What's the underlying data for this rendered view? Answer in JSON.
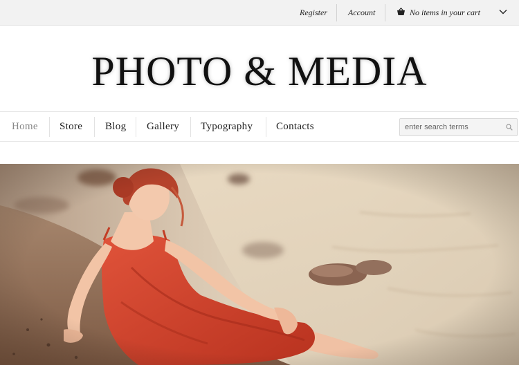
{
  "topbar": {
    "register_label": "Register",
    "account_label": "Account",
    "cart_label": "No items in your cart",
    "cart_icon": "basket-icon",
    "dropdown_icon": "chevron-down-icon"
  },
  "logo": {
    "text": "PHOTO & MEDIA"
  },
  "nav": {
    "items": [
      {
        "label": "Home",
        "active": true
      },
      {
        "label": "Store"
      },
      {
        "label": "Blog"
      },
      {
        "label": "Gallery"
      },
      {
        "label": "Typography"
      },
      {
        "label": "Contacts"
      }
    ],
    "search_placeholder": "enter search terms",
    "search_icon": "search-icon"
  },
  "hero": {
    "image_subject": "woman in red dress reclining on a beach by the water"
  },
  "colors": {
    "topbar_bg": "#f2f2f2",
    "dress": "#d2452a",
    "hair": "#b8402a",
    "sand": "#b89377",
    "water": "#efe3cf"
  }
}
